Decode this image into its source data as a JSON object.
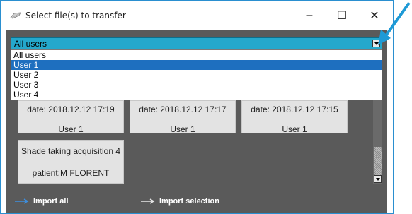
{
  "window": {
    "title": "Select file(s) to transfer",
    "controls": {
      "minimize": "–",
      "maximize": "☐",
      "close": "✕"
    }
  },
  "user_select": {
    "value": "All users",
    "options": [
      "All users",
      "User 1",
      "User 2",
      "User 3",
      "User 4"
    ],
    "highlighted": "User 1"
  },
  "cards": [
    {
      "line1": "date: 2018.12.12 17:19",
      "line2": "User 1"
    },
    {
      "line1": "date: 2018.12.12 17:17",
      "line2": "User 1"
    },
    {
      "line1": "date: 2018.12.12 17:15",
      "line2": "User 1"
    },
    {
      "line1": "Shade taking acquisition 4",
      "line2": "patient:M FLORENT"
    }
  ],
  "actions": {
    "import_all": "Import all",
    "import_selection": "Import selection"
  },
  "colors": {
    "accent": "#24a8cc",
    "selection": "#1e6fbf",
    "background": "#5a5a5a",
    "pointer": "#1e9ad6"
  },
  "icons": [
    "app-icon",
    "minimize-icon",
    "maximize-icon",
    "close-icon",
    "dropdown-arrow-icon",
    "arrow-right-icon",
    "pointer-arrow-icon"
  ]
}
